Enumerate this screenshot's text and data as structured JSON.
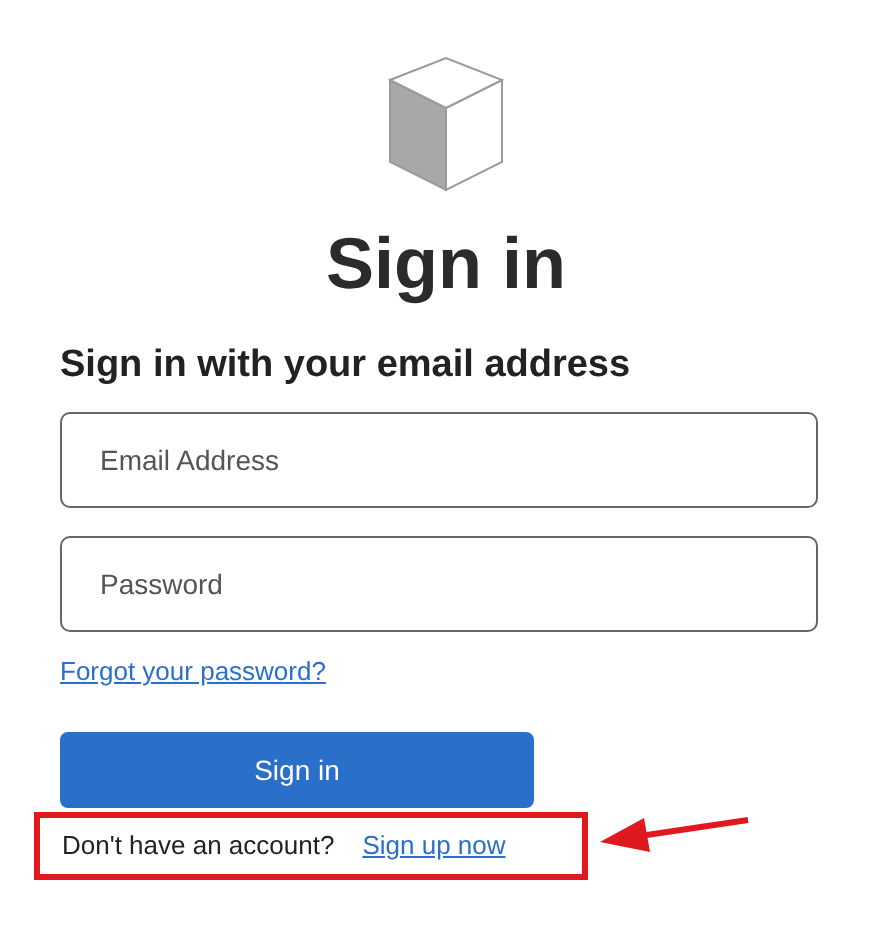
{
  "heading": "Sign in",
  "subheading": "Sign in with your email address",
  "fields": [
    {
      "placeholder": "Email Address"
    },
    {
      "placeholder": "Password"
    }
  ],
  "forgot_link": "Forgot your password?",
  "submit_button": "Sign in",
  "signup": {
    "prompt": "Don't have an account?",
    "link": "Sign up now"
  }
}
